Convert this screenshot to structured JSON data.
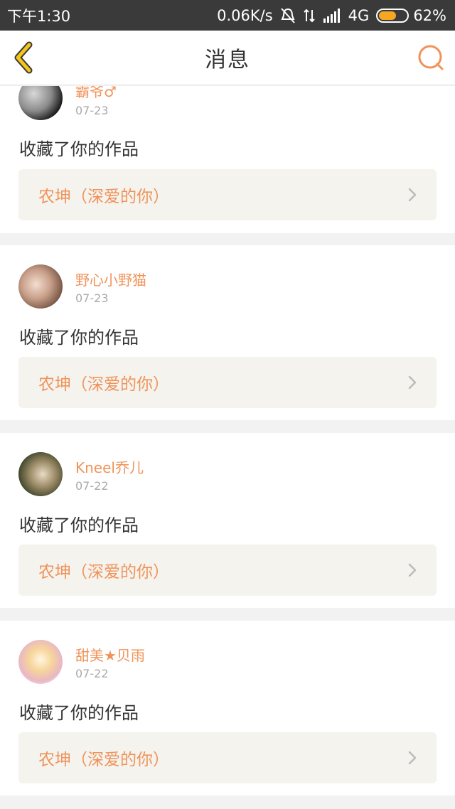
{
  "status_bar": {
    "time": "下午1:30",
    "speed": "0.06K/s",
    "network": "4G",
    "battery": "62%",
    "battery_level": 0.62,
    "icons": [
      "bell-muted-icon",
      "data-transfer-icon",
      "signal-icon",
      "battery-icon"
    ]
  },
  "nav": {
    "title": "消息",
    "back_icon": "chevron-left-icon",
    "search_icon": "search-icon",
    "accent_color": "#f0935a"
  },
  "messages": [
    {
      "user": "霸爷♂",
      "date": "07-23",
      "action": "收藏了你的作品",
      "work": "农坤（深爱的你）"
    },
    {
      "user": "野心小野猫",
      "date": "07-23",
      "action": "收藏了你的作品",
      "work": "农坤（深爱的你）"
    },
    {
      "user": "Kneel乔儿",
      "date": "07-22",
      "action": "收藏了你的作品",
      "work": "农坤（深爱的你）"
    },
    {
      "user": "甜美★贝雨",
      "date": "07-22",
      "action": "收藏了你的作品",
      "work": "农坤（深爱的你）"
    }
  ]
}
